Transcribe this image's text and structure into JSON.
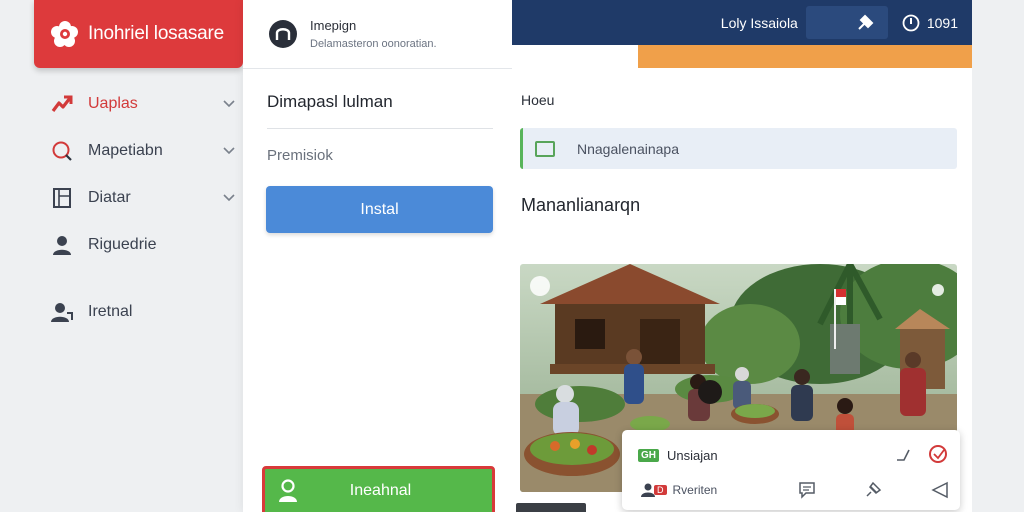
{
  "brand": {
    "name": "Inohriel losasare",
    "logo_icon": "flower-logo-icon"
  },
  "sidebar": {
    "items": [
      {
        "label": "Uaplas",
        "icon": "arrow-trend-icon",
        "active": true,
        "has_chevron": true
      },
      {
        "label": "Mapetiabn",
        "icon": "magnifier-icon",
        "active": false,
        "has_chevron": true
      },
      {
        "label": "Diatar",
        "icon": "document-icon",
        "active": false,
        "has_chevron": true
      },
      {
        "label": "Riguedrie",
        "icon": "user-icon",
        "active": false,
        "has_chevron": false
      },
      {
        "label": "Iretnal",
        "icon": "user-group-icon",
        "active": false,
        "has_chevron": false
      }
    ]
  },
  "panel": {
    "header_title": "Imepign",
    "header_subtitle": "Delamasteron oonoratian.",
    "title": "Dimapasl lulman",
    "subtitle": "Premisiok",
    "install_button": "Instal",
    "bottom_button": "Ineahnal"
  },
  "topbar": {
    "label": "Loly Issaiola",
    "time": "1091"
  },
  "main": {
    "section_label": "Hoeu",
    "input_text": "Nnagalenainapa",
    "heading": "Mananlianarqn"
  },
  "card": {
    "badge": "GH",
    "title": "Unsiajan",
    "sub_badge": "D",
    "subtitle": "Rveriten"
  },
  "colors": {
    "brand_red": "#dd3a3c",
    "navy": "#1f3a68",
    "orange": "#f0a04a",
    "install_blue": "#4b8ad8",
    "green": "#55b84a"
  }
}
